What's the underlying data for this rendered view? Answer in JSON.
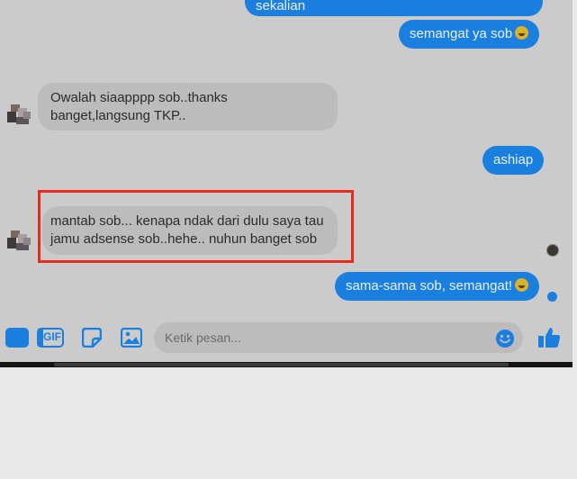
{
  "messages": [
    {
      "id": "m1",
      "side": "out",
      "text": "sekalian"
    },
    {
      "id": "m2",
      "side": "out",
      "text": "semangat ya sob",
      "emoji": "grinning-emoji"
    },
    {
      "id": "m3",
      "side": "in",
      "lines": [
        "Owalah siaapppp sob..thanks",
        "banget,langsung TKP.."
      ]
    },
    {
      "id": "m4",
      "side": "out",
      "text": "ashiap"
    },
    {
      "id": "m5",
      "side": "in",
      "highlighted": true,
      "lines": [
        "mantab sob... kenapa ndak dari dulu saya tau",
        "jamu adsense sob..hehe.. nuhun banget sob"
      ]
    },
    {
      "id": "m6",
      "side": "out",
      "text": "sama-sama sob, semangat!",
      "emoji": "grinning-emoji"
    }
  ],
  "composer": {
    "placeholder": "Ketik pesan...",
    "icons": [
      "camera-icon",
      "gif-icon",
      "sticker-icon",
      "image-icon",
      "emoji-icon",
      "like-icon"
    ],
    "gif_label": "GIF"
  },
  "colors": {
    "accent": "#1b7fe0",
    "highlight": "#e62c1c",
    "incoming_bubble": "#bcbcbc",
    "background": "#cbcbcb"
  }
}
